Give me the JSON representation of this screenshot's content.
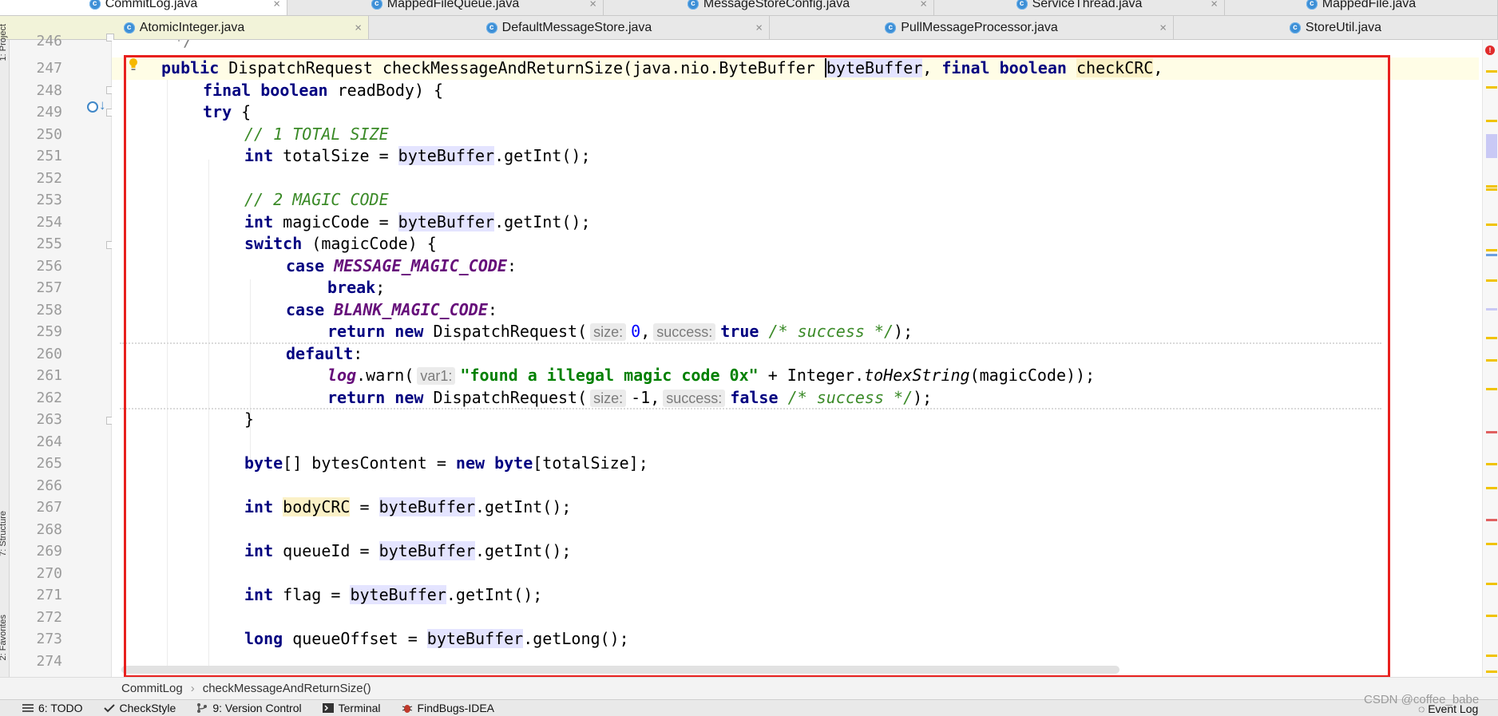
{
  "tabs_row1": [
    {
      "label": "CommitLog.java",
      "active": true
    },
    {
      "label": "MappedFileQueue.java",
      "active": false
    },
    {
      "label": "MessageStoreConfig.java",
      "active": false
    },
    {
      "label": "ServiceThread.java",
      "active": false
    },
    {
      "label": "MappedFile.java",
      "active": false
    }
  ],
  "tabs_row2": [
    {
      "label": "AtomicInteger.java"
    },
    {
      "label": "DefaultMessageStore.java"
    },
    {
      "label": "PullMessageProcessor.java"
    },
    {
      "label": "StoreUtil.java"
    }
  ],
  "tab_icon_letter": "c",
  "tab_close_glyph": "×",
  "left_tools": {
    "project": "1: Project",
    "structure": "7: Structure",
    "favorites": "2: Favorites"
  },
  "line_numbers": [
    "246",
    "247",
    "248",
    "249",
    "250",
    "251",
    "252",
    "253",
    "254",
    "255",
    "256",
    "257",
    "258",
    "259",
    "260",
    "261",
    "262",
    "263",
    "264",
    "265",
    "266",
    "267",
    "268",
    "269",
    "270",
    "271",
    "272",
    "273",
    "274"
  ],
  "code": {
    "l246": "*/",
    "l247": {
      "kw_public": "public",
      "type": "DispatchRequest",
      "method": "checkMessageAndReturnSize(java.nio.ByteBuffer ",
      "param1": "byteBuffer",
      "sep1": ", ",
      "kw_final": "final",
      "kw_boolean": "boolean",
      "param2": "checkCRC",
      "tail": ","
    },
    "l248": {
      "kw_final": "final",
      "kw_boolean": "boolean",
      "rest": "readBody) {"
    },
    "l249": {
      "kw_try": "try",
      "rest": " {"
    },
    "l250": "// 1 TOTAL SIZE",
    "l251": {
      "kw": "int",
      "lhs": " totalSize = ",
      "var": "byteBuffer",
      "rest": ".getInt();"
    },
    "l253": "// 2 MAGIC CODE",
    "l254": {
      "kw": "int",
      "lhs": " magicCode = ",
      "var": "byteBuffer",
      "rest": ".getInt();"
    },
    "l255": {
      "kw": "switch",
      "rest": " (magicCode) {"
    },
    "l256": {
      "kw": "case",
      "const": "MESSAGE_MAGIC_CODE",
      "rest": ":"
    },
    "l257": {
      "kw": "break",
      "rest": ";"
    },
    "l258": {
      "kw": "case",
      "const": "BLANK_MAGIC_CODE",
      "rest": ":"
    },
    "l259": {
      "kw_return": "return",
      "kw_new": "new",
      "type": "DispatchRequest(",
      "hint1": "size:",
      "val1": "0",
      "sep": ",",
      "hint2": "success:",
      "kw_true": "true",
      "cm": "/* success */",
      "rest": ");"
    },
    "l260": {
      "kw": "default",
      "rest": ":"
    },
    "l261": {
      "field": "log",
      "call": ".warn(",
      "hint": "var1:",
      "str": "\"found a illegal magic code 0x\"",
      "mid": " + Integer.",
      "smethod": "toHexString",
      "rest": "(magicCode));"
    },
    "l262": {
      "kw_return": "return",
      "kw_new": "new",
      "type": "DispatchRequest(",
      "hint1": "size:",
      "val1": "-1",
      "sep": ",",
      "hint2": "success:",
      "kw_false": "false",
      "cm": "/* success */",
      "rest": ");"
    },
    "l263": "}",
    "l265": {
      "kw_byte": "byte",
      "mid": "[] bytesContent = ",
      "kw_new": "new",
      "kw_byte2": "byte",
      "rest": "[totalSize];"
    },
    "l267": {
      "kw": "int",
      "sp": " ",
      "var_hl": "bodyCRC",
      "eq": " = ",
      "var": "byteBuffer",
      "rest": ".getInt();"
    },
    "l269": {
      "kw": "int",
      "lhs": " queueId = ",
      "var": "byteBuffer",
      "rest": ".getInt();"
    },
    "l271": {
      "kw": "int",
      "lhs": " flag = ",
      "var": "byteBuffer",
      "rest": ".getInt();"
    },
    "l273": {
      "kw": "long",
      "lhs": " queueOffset = ",
      "var": "byteBuffer",
      "rest": ".getLong();"
    }
  },
  "breadcrumb": [
    "CommitLog",
    "checkMessageAndReturnSize()"
  ],
  "bottom_tools": [
    {
      "label": "6: TODO"
    },
    {
      "label": "CheckStyle"
    },
    {
      "label": "9: Version Control"
    },
    {
      "label": "Terminal"
    },
    {
      "label": "FindBugs-IDEA"
    }
  ],
  "event_log": "Event Log",
  "watermark": "CSDN @coffee_babe",
  "colors": {
    "selection_border": "#e8201e",
    "keyword": "#000080",
    "comment": "#3a8a27",
    "constant": "#660e7a"
  }
}
